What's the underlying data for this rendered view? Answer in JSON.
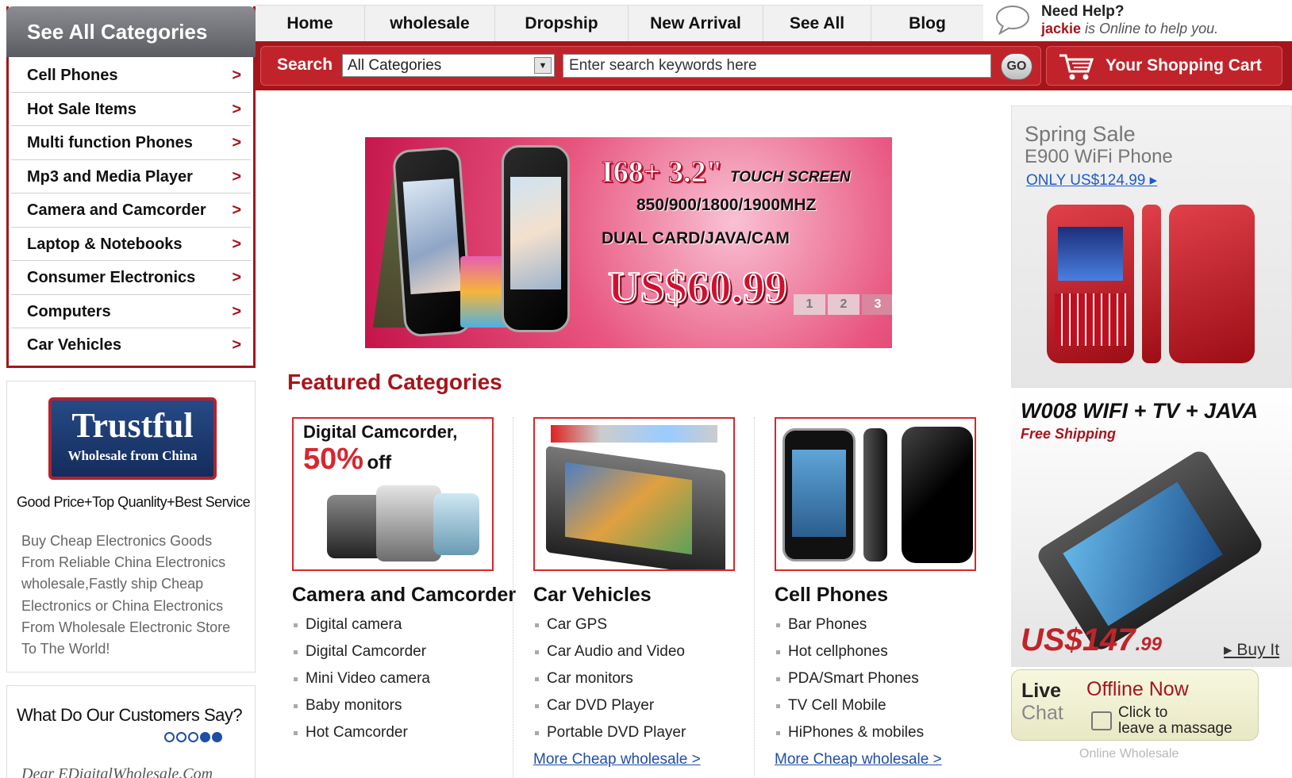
{
  "sidebar": {
    "title": "See All Categories",
    "items": [
      {
        "label": "Cell Phones"
      },
      {
        "label": "Hot Sale Items"
      },
      {
        "label": "Multi function Phones"
      },
      {
        "label": "Mp3 and Media Player"
      },
      {
        "label": "Camera and Camcorder"
      },
      {
        "label": "Laptop & Notebooks"
      },
      {
        "label": "Consumer Electronics"
      },
      {
        "label": "Computers"
      },
      {
        "label": "Car Vehicles"
      }
    ],
    "arrow": ">"
  },
  "nav": {
    "items": [
      {
        "label": "Home"
      },
      {
        "label": "wholesale"
      },
      {
        "label": "Dropship"
      },
      {
        "label": "New Arrival"
      },
      {
        "label": "See All"
      },
      {
        "label": "Blog"
      }
    ]
  },
  "help": {
    "title": "Need Help?",
    "user": "jackie",
    "status": " is Online to help you."
  },
  "search": {
    "label": "Search",
    "category": "All Categories",
    "placeholder": "Enter search keywords here",
    "go": "GO"
  },
  "cart": {
    "label": "Your Shopping Cart"
  },
  "banner": {
    "model": "I68+ 3.2\"",
    "model_sub": "TOUCH SCREEN",
    "freq": "850/900/1800/1900MHZ",
    "features": "DUAL CARD/JAVA/CAM",
    "price": "US$60.99",
    "pages": [
      "1",
      "2",
      "3"
    ],
    "active_page": "3"
  },
  "featured": {
    "title": "Featured Categories",
    "columns": [
      {
        "name": "Camera and Camcorder",
        "promo_line1": "Digital Camcorder,",
        "promo_pct": "50%",
        "promo_off": "off",
        "links": [
          "Digital camera",
          "Digital Camcorder",
          "Mini Video camera",
          "Baby monitors",
          "Hot Camcorder"
        ]
      },
      {
        "name": "Car Vehicles",
        "links": [
          "Car GPS",
          "Car Audio and Video",
          "Car monitors",
          "Car DVD Player",
          "Portable DVD Player"
        ],
        "more": "More Cheap wholesale >"
      },
      {
        "name": "Cell Phones",
        "links": [
          "Bar Phones",
          "Hot cellphones",
          "PDA/Smart Phones",
          "TV Cell Mobile",
          "HiPhones & mobiles"
        ],
        "more": "More Cheap wholesale >"
      }
    ]
  },
  "trust": {
    "badge_title": "Trustful",
    "badge_sub": "Wholesale from China",
    "tagline": "Good Price+Top Quanlity+Best Service",
    "text": "Buy Cheap Electronics Goods From Reliable China Electronics wholesale,Fastly ship Cheap Electronics or China Electronics From Wholesale Electronic Store To The World!"
  },
  "customers": {
    "title": "What Do Our Customers Say?",
    "quote": "Dear EDigitalWholesale.Com"
  },
  "ads": {
    "spring_title": "Spring Sale",
    "spring_product": "E900 WiFi Phone",
    "spring_price": "ONLY US$124.99",
    "w008_title": "W008 WIFI + TV + JAVA",
    "w008_ship": "Free Shipping",
    "w008_price_main": "US$147",
    "w008_price_cents": ".99",
    "w008_buy": "Buy It"
  },
  "livechat": {
    "live": "Live",
    "chat": "Chat",
    "status": "Offline Now",
    "click": "Click to",
    "leave": "leave a massage"
  },
  "footer_note": "Online Wholesale",
  "colors": {
    "brand_red": "#a4161c",
    "link_blue": "#1f4ea6"
  }
}
